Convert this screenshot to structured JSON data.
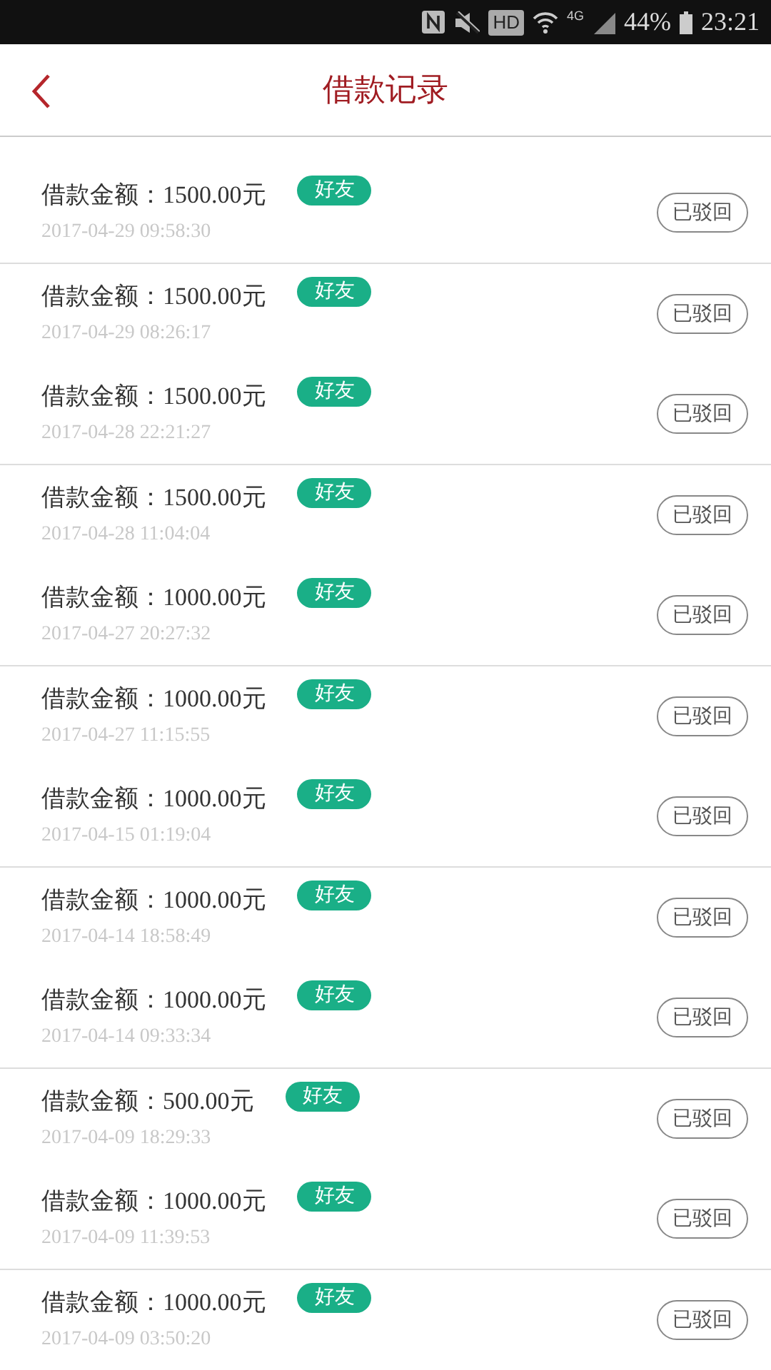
{
  "status_bar": {
    "hd": "HD",
    "network": "4G",
    "battery": "44%",
    "time": "23:21"
  },
  "header": {
    "title": "借款记录"
  },
  "records": [
    {
      "amount": "借款金额：1500.00元",
      "tag": "好友",
      "time": "2017-04-29 09:58:30",
      "action": "已驳回"
    },
    {
      "amount": "借款金额：1500.00元",
      "tag": "好友",
      "time": "2017-04-29 08:26:17",
      "action": "已驳回"
    },
    {
      "amount": "借款金额：1500.00元",
      "tag": "好友",
      "time": "2017-04-28 22:21:27",
      "action": "已驳回"
    },
    {
      "amount": "借款金额：1500.00元",
      "tag": "好友",
      "time": "2017-04-28 11:04:04",
      "action": "已驳回"
    },
    {
      "amount": "借款金额：1000.00元",
      "tag": "好友",
      "time": "2017-04-27 20:27:32",
      "action": "已驳回"
    },
    {
      "amount": "借款金额：1000.00元",
      "tag": "好友",
      "time": "2017-04-27 11:15:55",
      "action": "已驳回"
    },
    {
      "amount": "借款金额：1000.00元",
      "tag": "好友",
      "time": "2017-04-15 01:19:04",
      "action": "已驳回"
    },
    {
      "amount": "借款金额：1000.00元",
      "tag": "好友",
      "time": "2017-04-14 18:58:49",
      "action": "已驳回"
    },
    {
      "amount": "借款金额：1000.00元",
      "tag": "好友",
      "time": "2017-04-14 09:33:34",
      "action": "已驳回"
    },
    {
      "amount": "借款金额：500.00元",
      "tag": "好友",
      "time": "2017-04-09 18:29:33",
      "action": "已驳回"
    },
    {
      "amount": "借款金额：1000.00元",
      "tag": "好友",
      "time": "2017-04-09 11:39:53",
      "action": "已驳回"
    },
    {
      "amount": "借款金额：1000.00元",
      "tag": "好友",
      "time": "2017-04-09 03:50:20",
      "action": "已驳回"
    }
  ]
}
